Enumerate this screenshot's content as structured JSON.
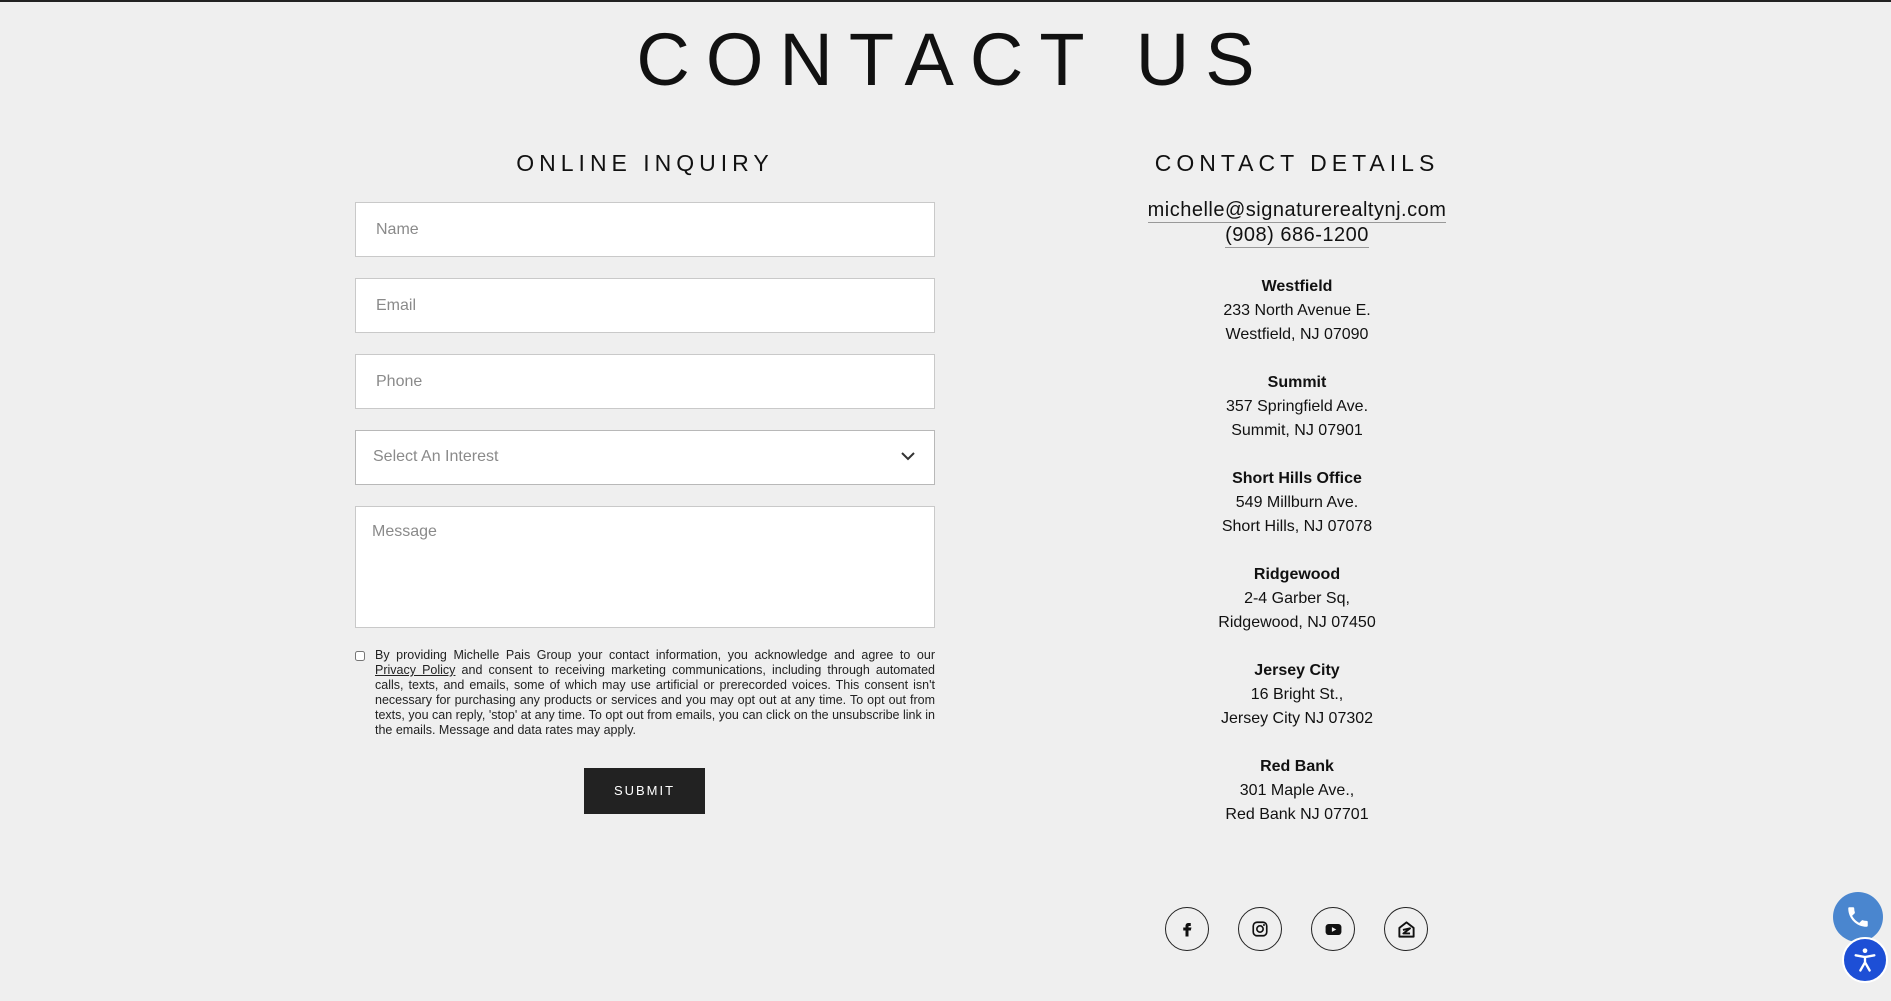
{
  "page": {
    "title": "CONTACT US"
  },
  "inquiry": {
    "heading": "ONLINE INQUIRY",
    "name_placeholder": "Name",
    "email_placeholder": "Email",
    "phone_placeholder": "Phone",
    "interest_selected": "Select An Interest",
    "message_placeholder": "Message",
    "consent_before": "By providing Michelle Pais Group your contact information, you acknowledge and agree to our ",
    "consent_link": "Privacy Policy",
    "consent_after": " and consent to receiving marketing communications, including through automated calls, texts, and emails, some of which may use artificial or prerecorded voices. This consent isn't necessary for purchasing any products or services and you may opt out at any time. To opt out from texts, you can reply, 'stop' at any time. To opt out from emails, you can click on the unsubscribe link in the emails. Message and data rates may apply.",
    "submit_label": "SUBMIT"
  },
  "contact": {
    "heading": "CONTACT DETAILS",
    "email": "michelle@signaturerealtynj.com",
    "phone": "(908) 686-1200",
    "offices": [
      {
        "name": "Westfield",
        "line1": "233 North Avenue E.",
        "line2": "Westfield, NJ 07090"
      },
      {
        "name": "Summit",
        "line1": "357 Springfield Ave.",
        "line2": "Summit, NJ 07901"
      },
      {
        "name": "Short Hills Office",
        "line1": "549 Millburn Ave.",
        "line2": "Short Hills, NJ 07078"
      },
      {
        "name": "Ridgewood",
        "line1": "2-4 Garber Sq,",
        "line2": "Ridgewood, NJ 07450"
      },
      {
        "name": "Jersey City",
        "line1": "16 Bright St.,",
        "line2": "Jersey City NJ 07302"
      },
      {
        "name": "Red Bank",
        "line1": "301 Maple Ave.,",
        "line2": "Red Bank NJ 07701"
      }
    ]
  },
  "social": {
    "icons": [
      "facebook-icon",
      "instagram-icon",
      "youtube-icon",
      "zillow-icon"
    ]
  },
  "floating": {
    "phone_icon": "phone-icon",
    "accessibility_icon": "accessibility-icon"
  },
  "colors": {
    "background": "#efefef",
    "button": "#222222",
    "phone_widget": "#4a86cf",
    "accessibility_widget": "#1d4fd6"
  }
}
